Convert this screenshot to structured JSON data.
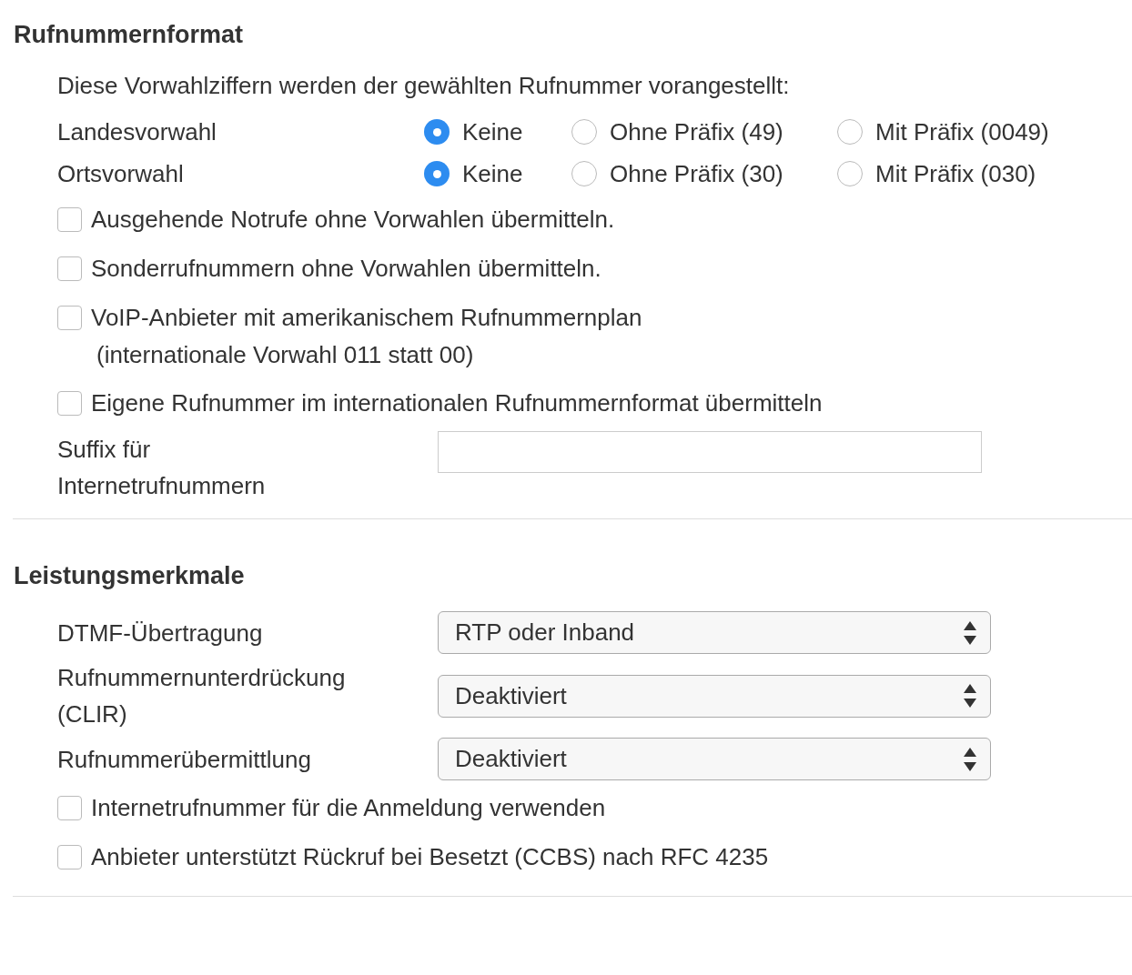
{
  "sections": [
    {
      "title": "Rufnummernformat",
      "items": [
        {
          "kind": "text",
          "text": "Diese Vorwahlziffern werden der gewählten Rufnummer vorangestellt:"
        },
        {
          "kind": "radio",
          "label": "Landesvorwahl",
          "options": [
            {
              "label": "Keine",
              "selected": true
            },
            {
              "label": "Ohne Präfix (49)",
              "selected": false
            },
            {
              "label": "Mit Präfix (0049)",
              "selected": false
            }
          ]
        },
        {
          "kind": "radio",
          "label": "Ortsvorwahl",
          "options": [
            {
              "label": "Keine",
              "selected": true
            },
            {
              "label": "Ohne Präfix (30)",
              "selected": false
            },
            {
              "label": "Mit Präfix (030)",
              "selected": false
            }
          ]
        },
        {
          "kind": "checkbox",
          "label": "Ausgehende Notrufe ohne Vorwahlen übermitteln.",
          "checked": false
        },
        {
          "kind": "checkbox",
          "label": "Sonderrufnummern ohne Vorwahlen übermitteln.",
          "checked": false
        },
        {
          "kind": "checkbox",
          "label": "VoIP-Anbieter mit amerikanischem Rufnummernplan",
          "note": "(internationale Vorwahl 011 statt 00)",
          "checked": false
        },
        {
          "kind": "checkbox",
          "label": "Eigene Rufnummer im internationalen Rufnummernformat übermitteln",
          "checked": false
        },
        {
          "kind": "input",
          "label": "Suffix für Internetrufnummern"
        }
      ]
    },
    {
      "title": "Leistungsmerkmale",
      "items": [
        {
          "kind": "select",
          "label": "DTMF-Übertragung",
          "value": "RTP oder Inband"
        },
        {
          "kind": "select",
          "label": "Rufnummernunterdrückung (CLIR)",
          "value": "Deaktiviert"
        },
        {
          "kind": "select",
          "label": "Rufnummerübermittlung",
          "value": "Deaktiviert"
        },
        {
          "kind": "checkbox",
          "label": "Internetrufnummer für die Anmeldung verwenden",
          "checked": false
        },
        {
          "kind": "checkbox",
          "label": "Anbieter unterstützt Rückruf bei Besetzt (CCBS) nach RFC 4235",
          "checked": false
        }
      ]
    }
  ]
}
